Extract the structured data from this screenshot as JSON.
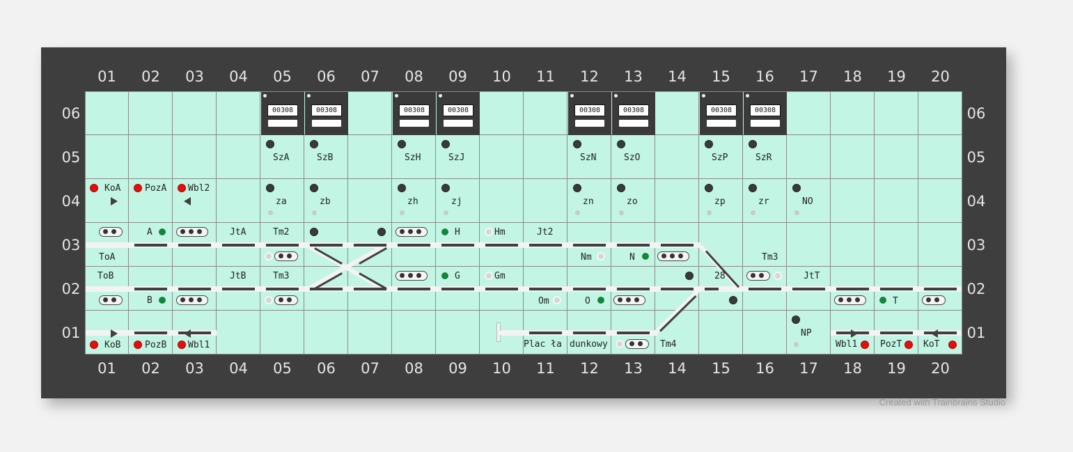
{
  "columns": [
    "01",
    "02",
    "03",
    "04",
    "05",
    "06",
    "07",
    "08",
    "09",
    "10",
    "11",
    "12",
    "13",
    "14",
    "15",
    "16",
    "17",
    "18",
    "19",
    "20"
  ],
  "rows": [
    "06",
    "05",
    "04",
    "03",
    "02",
    "01"
  ],
  "counter_value": "00308",
  "counter_columns": [
    4,
    5,
    7,
    8,
    11,
    12,
    14,
    15
  ],
  "labels": {
    "KoA": "KoA",
    "PozA": "PozA",
    "Wbl2": "Wbl2",
    "KoB": "KoB",
    "PozB": "PozB",
    "Wbl1_left": "Wbl1",
    "ToA": "ToA",
    "ToB": "ToB",
    "A": "A",
    "B": "B",
    "JtA": "JtA",
    "JtB": "JtB",
    "Tm2": "Tm2",
    "Tm3_left": "Tm3",
    "SzA": "SzA",
    "SzB": "SzB",
    "SzH": "SzH",
    "SzJ": "SzJ",
    "SzN": "SzN",
    "SzO": "SzO",
    "SzP": "SzP",
    "SzR": "SzR",
    "za": "za",
    "zb": "zb",
    "zh": "zh",
    "zj": "zj",
    "zn": "zn",
    "zo": "zo",
    "zp": "zp",
    "zr": "zr",
    "NO": "NO",
    "H": "H",
    "G": "G",
    "Hm": "Hm",
    "Gm": "Gm",
    "Jt2": "Jt2",
    "Nm": "Nm",
    "N": "N",
    "Om": "Om",
    "O": "O",
    "Tm3_right": "Tm3",
    "n28": "28",
    "JtT": "JtT",
    "T": "T",
    "NP": "NP",
    "Tm4": "Tm4",
    "Plac": "Plac ła",
    "dunkowy": "dunkowy",
    "Wbl1_right": "Wbl1",
    "PozT": "PozT",
    "KoT": "KoT"
  },
  "colors": {
    "red": "#e01010",
    "green": "#0a8a3a",
    "grid": "#c2f5e3",
    "frame": "#3e3e3e"
  },
  "credit": "Created with Trainbrains Studio"
}
